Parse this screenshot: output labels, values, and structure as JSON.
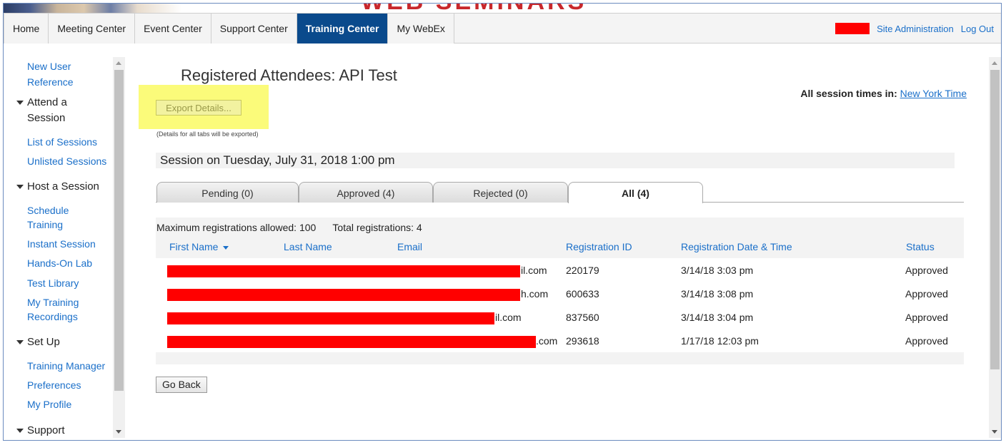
{
  "banner": {
    "brand_text": "WEB SEMINARS"
  },
  "nav": {
    "tabs": [
      {
        "label": "Home",
        "active": false
      },
      {
        "label": "Meeting Center",
        "active": false
      },
      {
        "label": "Event Center",
        "active": false
      },
      {
        "label": "Support Center",
        "active": false
      },
      {
        "label": "Training Center",
        "active": true
      },
      {
        "label": "My WebEx",
        "active": false
      }
    ],
    "site_admin": "Site Administration",
    "logout": "Log Out"
  },
  "sidebar": {
    "new_user_1": "New User",
    "new_user_2": "Reference",
    "attend_1": "Attend a",
    "attend_2": "Session",
    "list_sessions": "List of Sessions",
    "unlisted_sessions": "Unlisted Sessions",
    "host_session": "Host a Session",
    "schedule_1": "Schedule",
    "schedule_2": "Training",
    "instant_session": "Instant Session",
    "hands_on_lab": "Hands-On Lab",
    "test_library": "Test Library",
    "recordings_1": "My Training",
    "recordings_2": "Recordings",
    "set_up": "Set Up",
    "training_manager": "Training Manager",
    "preferences": "Preferences",
    "my_profile": "My Profile",
    "support": "Support"
  },
  "main": {
    "title": "Registered Attendees: API Test",
    "export_button": "Export Details...",
    "export_note": "(Details for all tabs will be exported)",
    "tz_label": "All session times in:",
    "tz_value": "New York Time",
    "session": "Session on Tuesday, July 31, 2018 1:00 pm",
    "status_tabs": [
      {
        "label": "Pending (0)",
        "active": false
      },
      {
        "label": "Approved (4)",
        "active": false
      },
      {
        "label": "Rejected (0)",
        "active": false
      },
      {
        "label": "All (4)",
        "active": true
      }
    ],
    "summary_max": "Maximum registrations allowed: 100",
    "summary_total": "Total registrations: 4",
    "columns": {
      "first_name": "First Name",
      "last_name": "Last Name",
      "email": "Email",
      "reg_id": "Registration ID",
      "reg_date": "Registration Date & Time",
      "status": "Status"
    },
    "rows": [
      {
        "email_tail": "il.com",
        "reg_id": "220179",
        "reg_date": "3/14/18 3:03 pm",
        "status": "Approved"
      },
      {
        "email_tail": "h.com",
        "reg_id": "600633",
        "reg_date": "3/14/18 3:08 pm",
        "status": "Approved"
      },
      {
        "email_tail": "il.com",
        "reg_id": "837560",
        "reg_date": "3/14/18 3:04 pm",
        "status": "Approved"
      },
      {
        "email_tail": ".com",
        "reg_id": "293618",
        "reg_date": "1/17/18 12:03 pm",
        "status": "Approved"
      }
    ],
    "go_back": "Go Back"
  },
  "colors": {
    "active_tab": "#0a4a8c",
    "link": "#1a6fc9",
    "redaction": "#ff0000",
    "highlight": "#fbfb7a"
  }
}
